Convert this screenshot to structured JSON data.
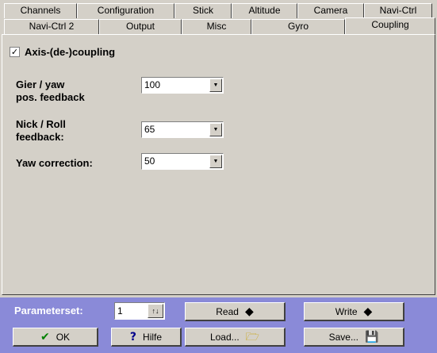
{
  "tabs_row1": [
    "Channels",
    "Configuration",
    "Stick",
    "Altitude",
    "Camera",
    "Navi-Ctrl"
  ],
  "tabs_row2": [
    "Navi-Ctrl 2",
    "Output",
    "Misc",
    "Gyro",
    "Coupling"
  ],
  "active_tab": "Coupling",
  "coupling": {
    "checkbox_label": "Axis-(de-)coupling",
    "checked": true,
    "check_mark": "✓",
    "params": [
      {
        "label_line1": "Gier / yaw",
        "label_line2": "pos. feedback",
        "value": "100"
      },
      {
        "label_line1": "Nick / Roll",
        "label_line2": "feedback:",
        "value": "65"
      },
      {
        "label_line1": "Yaw correction:",
        "label_line2": "",
        "value": "50"
      }
    ]
  },
  "bottom": {
    "parameterset_label": "Parameterset:",
    "parameterset_value": "1",
    "buttons": {
      "read": "Read",
      "write": "Write",
      "ok": "OK",
      "help": "Hilfe",
      "load": "Load...",
      "save": "Save..."
    }
  },
  "colors": {
    "bottom_bar": "#8a8ad8",
    "background": "#d4d0c8"
  }
}
